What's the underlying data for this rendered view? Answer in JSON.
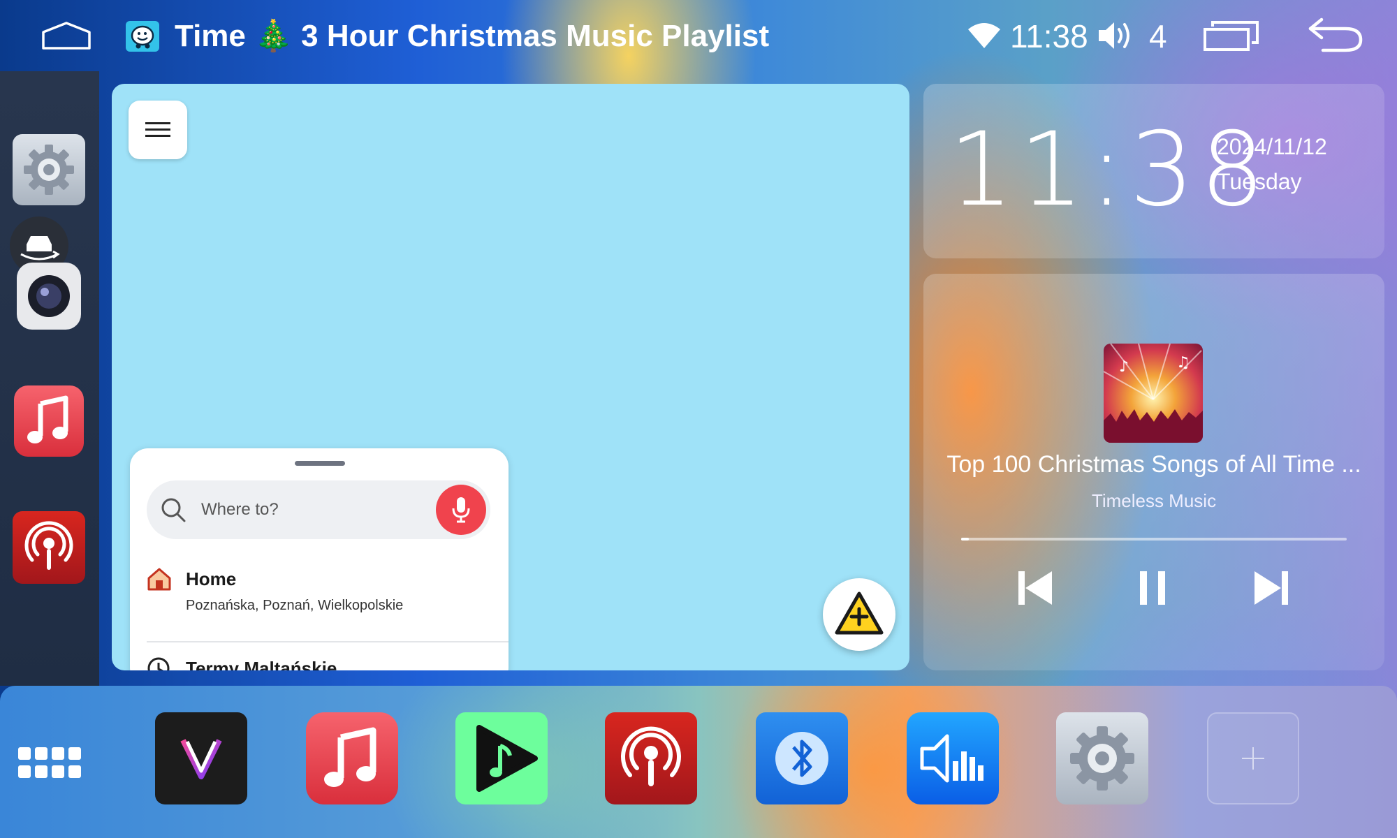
{
  "status_bar": {
    "title": "Time 🎄 3 Hour Christmas Music Playlist",
    "time": "11:38",
    "volume_level": "4",
    "icons": [
      "home-outline-icon",
      "waze-icon",
      "wifi-icon",
      "volume-icon",
      "recent-apps-icon",
      "back-icon"
    ]
  },
  "left_rail": {
    "apps": [
      "settings-icon",
      "camera-360-icon",
      "dashcam-icon",
      "music-icon",
      "podcast-icon"
    ]
  },
  "map": {
    "search_placeholder": "Where to?",
    "favorites": [
      {
        "title": "Home",
        "subtitle": "Poznańska, Poznań, Wielkopolskie"
      },
      {
        "title": "Termy Maltańskie",
        "subtitle": ""
      }
    ],
    "buttons": [
      "menu-icon",
      "mic-icon",
      "report-hazard-icon"
    ]
  },
  "clock_widget": {
    "time": "11:38",
    "date": "2024/11/12",
    "day": "Tuesday"
  },
  "music_widget": {
    "track_title": "Top 100 Christmas Songs of All Time ...",
    "artist": "Timeless Music",
    "progress": 0.02,
    "controls": [
      "previous-icon",
      "pause-icon",
      "next-icon"
    ]
  },
  "dock": {
    "apps": [
      "app-grid-icon",
      "v-app-icon",
      "music-icon",
      "play-music-icon",
      "podcast-icon",
      "bluetooth-icon",
      "equalizer-icon",
      "settings-icon",
      "add-icon"
    ]
  },
  "colors": {
    "map_background": "#9fe2f8",
    "mic_red": "#f0434d",
    "hazard_yellow": "#ffd21f"
  }
}
